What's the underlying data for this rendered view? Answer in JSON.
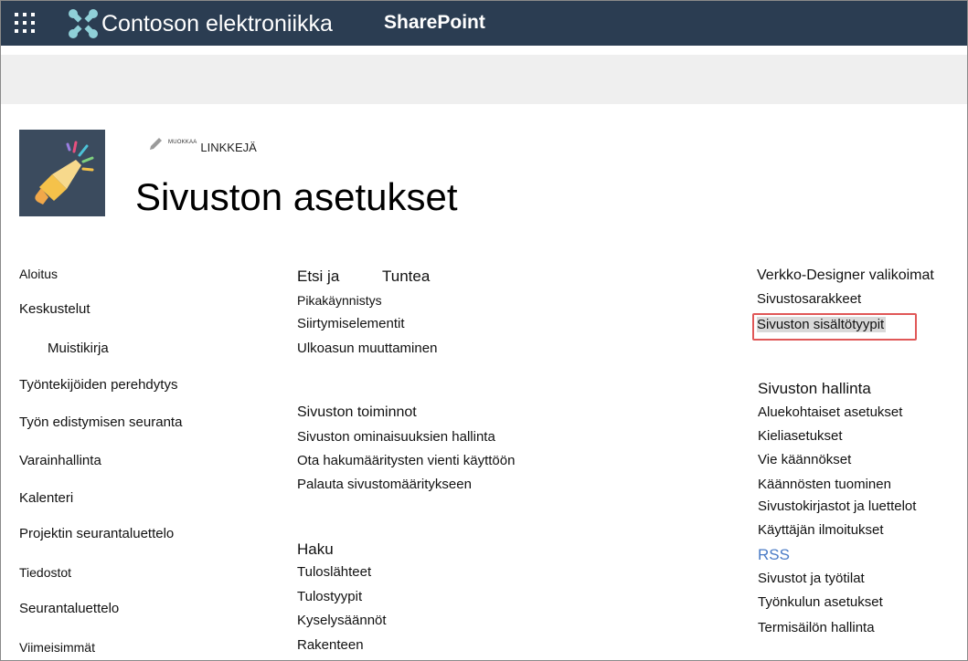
{
  "suite_bar": {
    "org_name": "Contoson elektroniikka",
    "app_name": "SharePoint",
    "background": "#2b3d52",
    "waffle_icon": "app-launcher-icon",
    "logo_icon": "contoso-logo-icon"
  },
  "header": {
    "site_logo_icon": "megaphone-icon",
    "edit_icon": "pencil-icon",
    "edit_prefix": "MUOKKAA",
    "edit_links": "LINKKEJÄ",
    "title": "Sivuston asetukset"
  },
  "left_nav": [
    "Aloitus",
    "Keskustelut",
    "Muistikirja",
    "Työntekijöiden perehdytys",
    "Työn edistymisen seuranta",
    "Varainhallinta",
    "Kalenteri",
    "Projektin seurantaluettelo",
    "Tiedostot",
    "Seurantaluettelo",
    "Viimeisimmät"
  ],
  "sections": {
    "look_feel": {
      "title_a": "Etsi ja",
      "title_b": "Tuntea",
      "links": [
        "Pikakäynnistys",
        "Siirtymiselementit",
        "Ulkoasun muuttaminen"
      ]
    },
    "site_actions": {
      "title": "Sivuston toiminnot",
      "links": [
        "Sivuston ominaisuuksien hallinta",
        "Ota hakumääritysten vienti käyttöön",
        "Palauta sivustomääritykseen"
      ]
    },
    "search": {
      "title": "Haku",
      "links": [
        "Tuloslähteet",
        "Tulostyypit",
        "Kyselysäännöt",
        "Rakenteen"
      ]
    },
    "web_designer": {
      "title": "Verkko-Designer valikoimat",
      "links": [
        "Sivustosarakkeet",
        "Sivuston sisältötyypit"
      ]
    },
    "site_admin": {
      "title": "Sivuston hallinta",
      "links": [
        "Aluekohtaiset asetukset",
        "Kieliasetukset",
        "Vie käännökset",
        "Käännösten tuominen",
        "Sivustokirjastot ja luettelot",
        "Käyttäjän ilmoitukset",
        "RSS",
        "Sivustot ja työtilat",
        "Työnkulun asetukset",
        "Termisäilön hallinta"
      ]
    }
  },
  "colors": {
    "highlight_box": "#e05757",
    "rss_link": "#4a7bc6"
  }
}
